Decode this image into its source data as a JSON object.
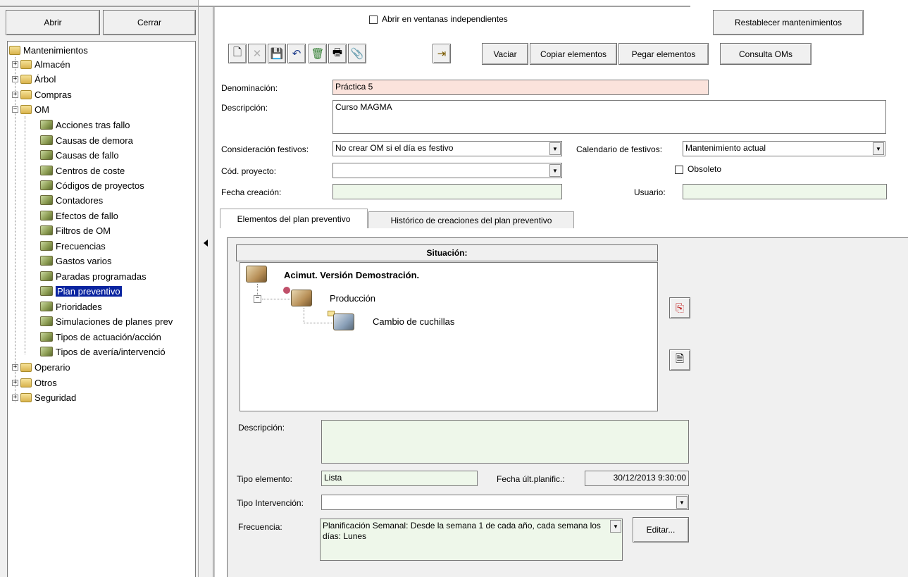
{
  "left_panel": {
    "open_button": "Abrir",
    "close_button": "Cerrar",
    "tree": {
      "root": "Mantenimientos",
      "groups": [
        {
          "label": "Almacén"
        },
        {
          "label": "Árbol"
        },
        {
          "label": "Compras"
        },
        {
          "label": "OM"
        }
      ],
      "om_items": [
        "Acciones tras fallo",
        "Causas de demora",
        "Causas de fallo",
        "Centros de coste",
        "Códigos de proyectos",
        "Contadores",
        "Efectos de fallo",
        "Filtros de OM",
        "Frecuencias",
        "Gastos varios",
        "Paradas programadas",
        "Plan preventivo",
        "Prioridades",
        "Simulaciones de planes prev",
        "Tipos de actuación/acción",
        "Tipos de avería/intervenció"
      ],
      "bottom_groups": [
        "Operario",
        "Otros",
        "Seguridad"
      ],
      "selected": "Plan preventivo"
    }
  },
  "top_bar": {
    "independent_windows_label": "Abrir en ventanas independientes",
    "reset_button": "Restablecer mantenimientos"
  },
  "toolbar": {
    "vaciar": "Vaciar",
    "copiar": "Copiar elementos",
    "pegar": "Pegar  elementos",
    "consulta": "Consulta OMs"
  },
  "form": {
    "denominacion_label": "Denominación:",
    "denominacion_value": "Práctica 5",
    "descripcion_label": "Descripción:",
    "descripcion_value": "Curso MAGMA",
    "festivos_label": "Consideración festivos:",
    "festivos_value": "No crear OM si el día es festivo",
    "calendario_label": "Calendario de festivos:",
    "calendario_value": "Mantenimiento actual",
    "proyecto_label": "Cód. proyecto:",
    "proyecto_value": "",
    "obsoleto_label": "Obsoleto",
    "fecha_label": "Fecha creación:",
    "fecha_value": "",
    "usuario_label": "Usuario:",
    "usuario_value": ""
  },
  "tabs": [
    {
      "label": "Elementos del plan preventivo"
    },
    {
      "label": "Histórico de creaciones del plan preventivo"
    }
  ],
  "situacion": {
    "header": "Situación:",
    "root": "Acimut. Versión Demostración.",
    "child": "Producción",
    "grandchild": "Cambio de cuchillas"
  },
  "details": {
    "descripcion_label": "Descripción:",
    "descripcion_value": "",
    "tipo_label": "Tipo elemento:",
    "tipo_value": "Lista",
    "fecha_label": "Fecha últ.planific.:",
    "fecha_value": "30/12/2013 9:30:00",
    "intervencion_label": "Tipo Intervención:",
    "intervencion_value": "",
    "frecuencia_label": "Frecuencia:",
    "frecuencia_value": "Planificación Semanal: Desde la semana 1 de cada año, cada semana los días:  Lunes",
    "editar_button": "Editar..."
  }
}
